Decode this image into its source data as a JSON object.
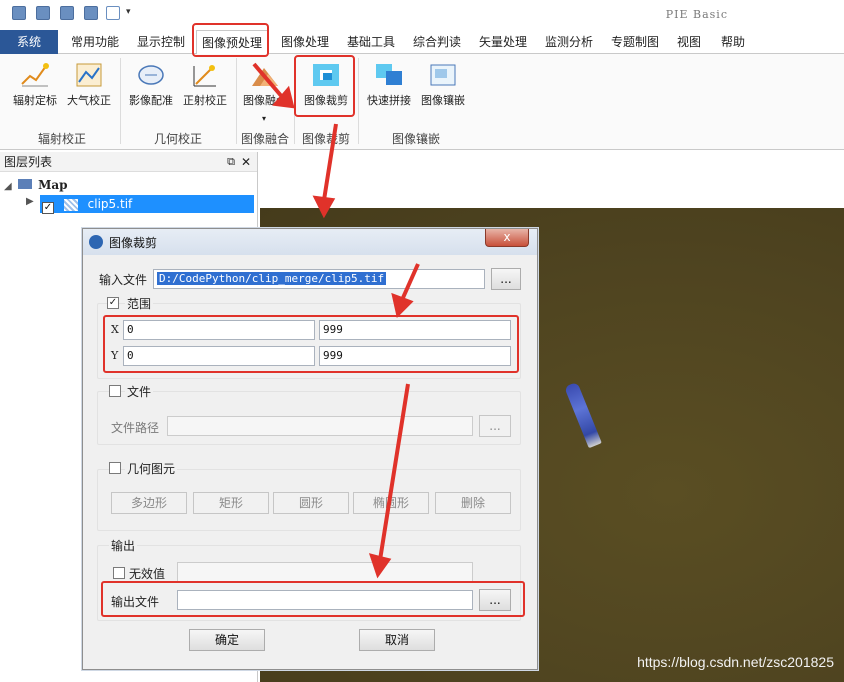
{
  "app": {
    "title": "PIE Basic"
  },
  "tabs": {
    "items": [
      "系统",
      "常用功能",
      "显示控制",
      "图像预处理",
      "图像处理",
      "基础工具",
      "综合判读",
      "矢量处理",
      "监测分析",
      "专题制图",
      "视图",
      "帮助"
    ],
    "active": "图像预处理"
  },
  "ribbon": {
    "buttons": [
      "辐射定标",
      "大气校正",
      "影像配准",
      "正射校正",
      "图像融合",
      "图像裁剪",
      "快速拼接",
      "图像镶嵌"
    ],
    "groups": [
      "辐射校正",
      "几何校正",
      "图像融合",
      "图像裁剪",
      "图像镶嵌"
    ]
  },
  "layer_panel": {
    "title": "图层列表",
    "root": "Map",
    "layer": "clip5.tif"
  },
  "dialog": {
    "title": "图像裁剪",
    "close": "x",
    "input_label": "输入文件",
    "input_value": "D:/CodePython/clip_merge/clip5.tif",
    "browse": "...",
    "range_label": "范围",
    "x_label": "X",
    "y_label": "Y",
    "x_min": "0",
    "x_max": "999",
    "y_min": "0",
    "y_max": "999",
    "file_label": "文件",
    "file_path_label": "文件路径",
    "geom_label": "几何图元",
    "geom_buttons": [
      "多边形",
      "矩形",
      "圆形",
      "椭圆形",
      "删除"
    ],
    "output_group": "输出",
    "nodata_label": "无效值",
    "output_file_label": "输出文件",
    "ok": "确定",
    "cancel": "取消"
  },
  "watermark": "https://blog.csdn.net/zsc201825",
  "colors": {
    "accent": "#2b5797",
    "highlight": "#e0322a",
    "selection": "#1e90ff"
  }
}
